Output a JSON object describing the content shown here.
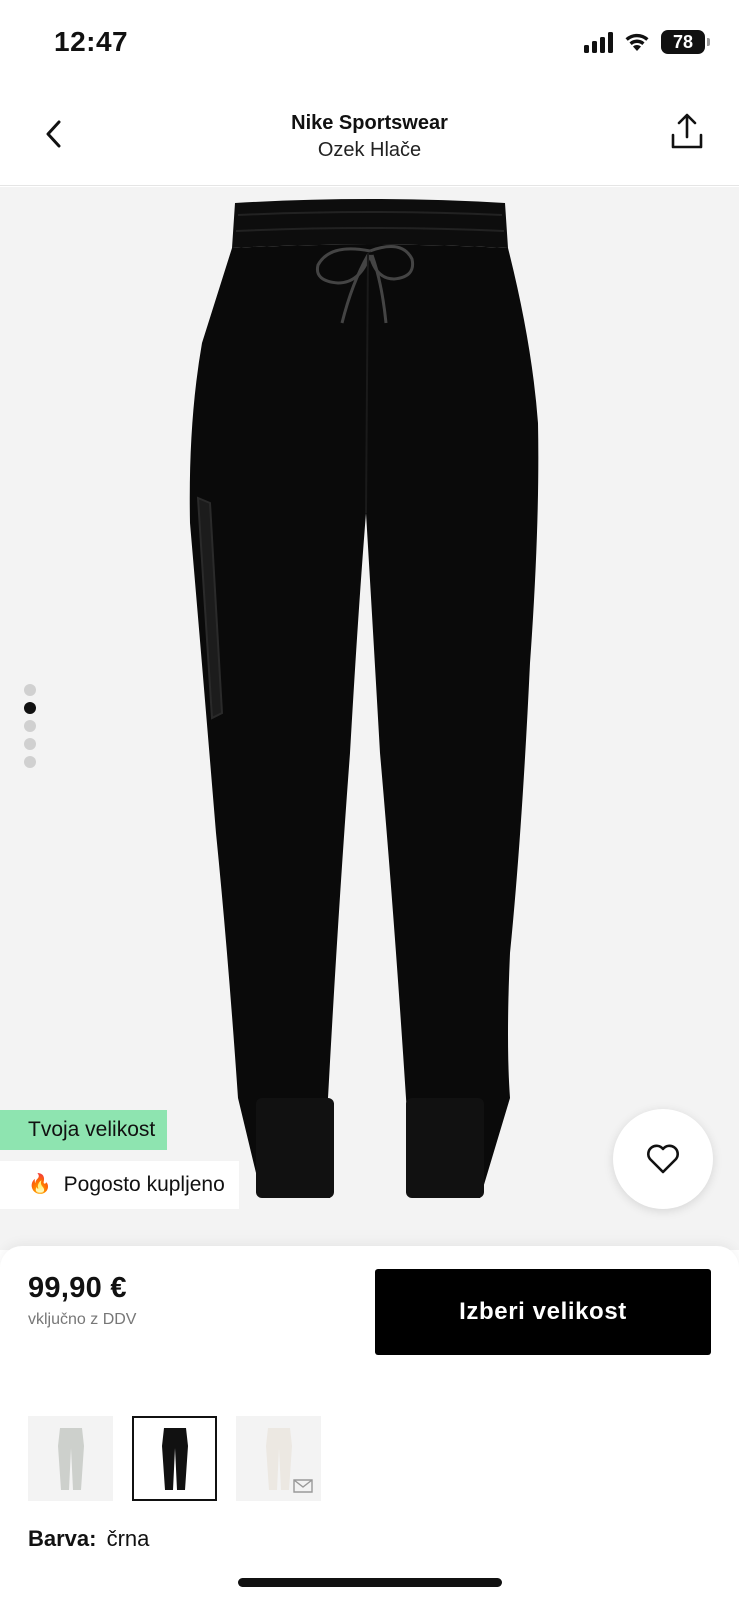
{
  "status": {
    "time": "12:47",
    "battery": "78"
  },
  "header": {
    "brand": "Nike Sportswear",
    "product": "Ozek Hlače"
  },
  "gallery": {
    "image_count": 5,
    "active_index": 1,
    "badge_size": "Tvoja velikost",
    "badge_popular": "Pogosto kupljeno"
  },
  "purchase": {
    "price": "99,90 €",
    "price_note": "vključno z DDV",
    "size_button": "Izberi velikost"
  },
  "variants": [
    {
      "color": "#cdd0cc",
      "selected": false
    },
    {
      "color": "#111111",
      "selected": true
    },
    {
      "color": "#ece8e2",
      "selected": false,
      "notify": true
    }
  ],
  "color": {
    "label": "Barva:",
    "value": "črna"
  }
}
